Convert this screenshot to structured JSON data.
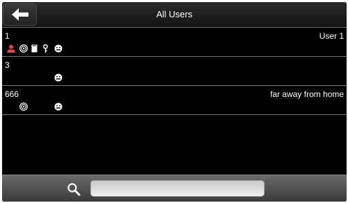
{
  "header": {
    "title": "All Users",
    "back_icon": "back-arrow-icon"
  },
  "users": [
    {
      "id": "1",
      "name": "User 1",
      "methods": [
        "user",
        "fingerprint",
        "card",
        "password",
        "face"
      ]
    },
    {
      "id": "3",
      "name": "",
      "methods": [
        "face"
      ]
    },
    {
      "id": "666",
      "name": "far away from home",
      "methods": [
        "fingerprint",
        "face"
      ]
    }
  ],
  "search": {
    "value": "",
    "placeholder": "",
    "icon": "search-icon"
  },
  "colors": {
    "user_icon": "#e04848",
    "icon": "#ffffff",
    "background": "#000000"
  }
}
